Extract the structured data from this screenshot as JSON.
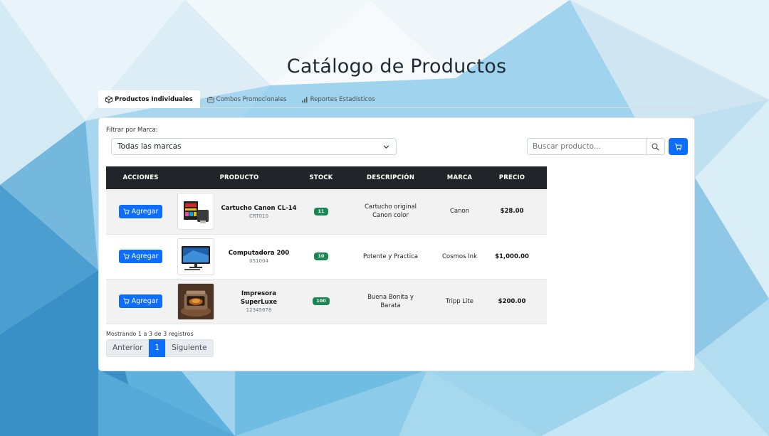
{
  "page": {
    "title": "Catálogo de Productos"
  },
  "tabs": [
    {
      "label": "Productos Individuales",
      "icon": "box-icon",
      "active": true
    },
    {
      "label": "Combos Promocionales",
      "icon": "briefcase-icon",
      "active": false
    },
    {
      "label": "Reportes Estadísticos",
      "icon": "bar-chart-icon",
      "active": false
    }
  ],
  "filter": {
    "label": "Filtrar por Marca:",
    "selected": "Todas las marcas"
  },
  "search": {
    "placeholder": "Buscar producto..."
  },
  "table": {
    "headers": [
      "ACCIONES",
      "PRODUCTO",
      "STOCK",
      "DESCRIPCIÓN",
      "MARCA",
      "PRECIO"
    ],
    "rows": [
      {
        "action": "Agregar",
        "name": "Cartucho Canon CL-14",
        "code": "CRT010",
        "image": "ink-cartridge",
        "stock": "11",
        "description": "Cartucho original Canon color",
        "brand": "Canon",
        "price": "$28.00"
      },
      {
        "action": "Agregar",
        "name": "Computadora 200",
        "code": "051004",
        "image": "desktop-computer",
        "stock": "10",
        "description": "Potente y Practica",
        "brand": "Cosmos Ink",
        "price": "$1,000.00"
      },
      {
        "action": "Agregar",
        "name": "Impresora SuperLuxe",
        "code": "12345678",
        "image": "printer-photo",
        "stock": "100",
        "description": "Buena Bonita y Barata",
        "brand": "Tripp Lite",
        "price": "$200.00"
      }
    ]
  },
  "pagination": {
    "info": "Mostrando 1 a 3 de 3 registros",
    "prev": "Anterior",
    "current": "1",
    "next": "Siguiente"
  },
  "colors": {
    "primary": "#0d6efd",
    "header_dark": "#212529",
    "stock_green": "#198754"
  }
}
